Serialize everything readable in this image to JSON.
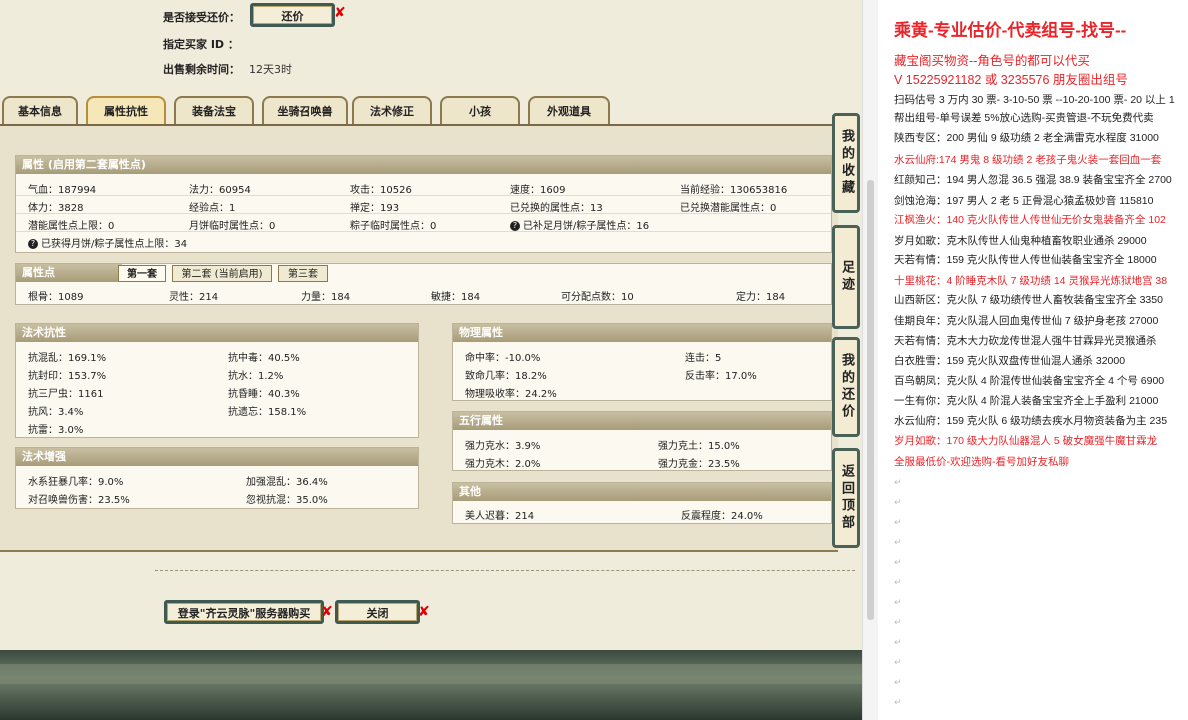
{
  "top": {
    "accept_counter_label": "是否接受还价：",
    "counter_button": "还价",
    "buyer_id_label": "指定买家 ID ：",
    "remaining_label": "出售剩余时间：",
    "remaining_value": "12天3时"
  },
  "tabs": [
    "基本信息",
    "属性抗性",
    "装备法宝",
    "坐骑召唤兽",
    "法术修正",
    "小孩",
    "外观道具"
  ],
  "attributes": {
    "header": "属性 (启用第二套属性点)",
    "rows": [
      [
        "气血：187994",
        "法力：60954",
        "攻击：10526",
        "速度：1609",
        "当前经验：130653816"
      ],
      [
        "体力：3828",
        "经验点：1",
        "禅定：193",
        "已兑换的属性点：13",
        "已兑换潜能属性点：0"
      ],
      [
        "潜能属性点上限：0",
        "月饼临时属性点：0",
        "粽子临时属性点：0",
        "已补足月饼/粽子属性点：16",
        ""
      ]
    ],
    "last_row": "已获得月饼/粽子属性点上限：34"
  },
  "points": {
    "header": "属性点",
    "subtabs": [
      "第一套",
      "第二套 (当前启用)",
      "第三套"
    ],
    "values": [
      "根骨：1089",
      "灵性：214",
      "力量：184",
      "敏捷：184",
      "可分配点数：10",
      "定力：184"
    ]
  },
  "spell_resist": {
    "header": "法术抗性",
    "rows": [
      [
        "抗混乱：169.1%",
        "抗中毒：40.5%"
      ],
      [
        "抗封印：153.7%",
        "抗水：1.2%"
      ],
      [
        "抗三尸虫：1161",
        "抗昏睡：40.3%"
      ],
      [
        "抗风：3.4%",
        "抗遗忘：158.1%"
      ],
      [
        "抗雷：3.0%",
        ""
      ]
    ]
  },
  "physical": {
    "header": "物理属性",
    "rows": [
      [
        "命中率：-10.0%",
        "连击：5"
      ],
      [
        "致命几率：18.2%",
        "反击率：17.0%"
      ],
      [
        "物理吸收率：24.2%",
        ""
      ]
    ]
  },
  "five_elements": {
    "header": "五行属性",
    "rows": [
      [
        "强力克水：3.9%",
        "强力克土：15.0%"
      ],
      [
        "强力克木：2.0%",
        "强力克金：23.5%"
      ]
    ]
  },
  "spell_boost": {
    "header": "法术增强",
    "rows": [
      [
        "水系狂暴几率：9.0%",
        "加强混乱：36.4%"
      ],
      [
        "对召唤兽伤害：23.5%",
        "忽视抗混：35.0%"
      ]
    ]
  },
  "other": {
    "header": "其他",
    "rows": [
      [
        "美人迟暮：214",
        "反震程度：24.0%"
      ]
    ]
  },
  "side_buttons": [
    "我的收藏",
    "足迹",
    "我的还价",
    "返回顶部"
  ],
  "bottom": {
    "login_buy": "登录\"齐云灵脉\"服务器购买",
    "close": "关闭"
  },
  "doc": {
    "title": "乘黄-专业估价-代卖组号-找号--",
    "lines": [
      {
        "t": "藏宝阁买物资--角色号的都可以代买",
        "c": "red"
      },
      {
        "t": "V 15225921182 或 3235576 朋友圈出组号",
        "c": "red"
      },
      {
        "t": "扫码估号 3 万内 30 票- 3-10-50 票 --10-20-100 票- 20 以上 1",
        "c": "black"
      },
      {
        "t": "帮出组号-单号误差 5%放心选购-买贵管退-不玩免费代卖",
        "c": "black"
      },
      {
        "t": "陕西专区：200 男仙 9 级功绩 2 老全满雷克水程度 31000",
        "c": "black"
      },
      {
        "t": "水云仙府:174 男鬼 8 级功绩 2 老孩子鬼火装一套回血一套",
        "c": "red"
      },
      {
        "t": "红颜知己：194 男人忽混 36.5 强混 38.9 装备宝宝齐全 2700",
        "c": "black"
      },
      {
        "t": "剑蚀沧海：197 男人 2 老 5 正骨混心猿孟极妙音 115810",
        "c": "black"
      },
      {
        "t": "江枫渔火：140 克火队传世人传世仙无价女鬼装备齐全 102",
        "c": "red"
      },
      {
        "t": "岁月如歌：克木队传世人仙鬼种植畜牧职业通杀 29000",
        "c": "black"
      },
      {
        "t": "天若有情：159 克火队传世人传世仙装备宝宝齐全 18000",
        "c": "black"
      },
      {
        "t": "十里桃花：4 阶睡克木队 7 级功绩 14 灵猴异光炼狱地宫 38",
        "c": "red"
      },
      {
        "t": "山西新区：克火队 7 级功绩传世人畜牧装备宝宝齐全 3350",
        "c": "black"
      },
      {
        "t": "佳期良年：克火队混人回血鬼传世仙 7 级护身老孩 27000",
        "c": "black"
      },
      {
        "t": "天若有情：克木大力砍龙传世混人强牛甘霖异光灵猴通杀",
        "c": "black"
      },
      {
        "t": "白衣胜雪：159 克火队双盘传世仙混人通杀 32000",
        "c": "black"
      },
      {
        "t": "百鸟朝凤：克火队 4 阶混传世仙装备宝宝齐全 4 个号 6900",
        "c": "black"
      },
      {
        "t": "一生有你：克火队 4 阶混人装备宝宝齐全上手盈利 21000",
        "c": "black"
      },
      {
        "t": "水云仙府：159 克火队 6 级功绩去疾水月物资装备为主 235",
        "c": "black"
      },
      {
        "t": "岁月如歌：170 级大力队仙器混人 5 破女魔强牛魔甘霖龙",
        "c": "red"
      },
      {
        "t": "全服最低价-欢迎选购-看号加好友私聊",
        "c": "red"
      }
    ]
  }
}
